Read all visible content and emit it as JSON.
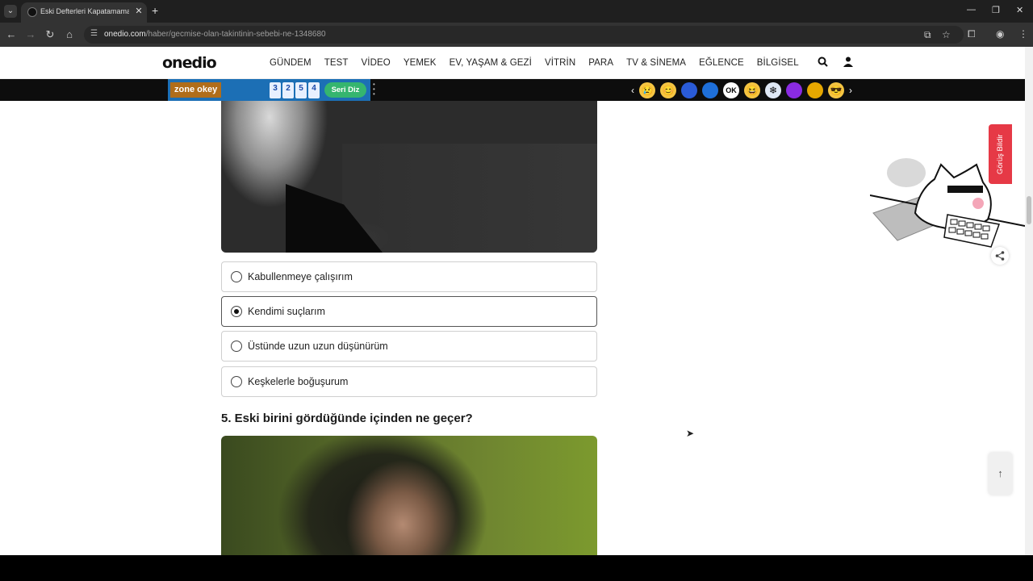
{
  "browser": {
    "tab_title": "Eski Defterleri Kapatamamanın",
    "tab_close": "✕",
    "new_tab": "+",
    "url_host": "onedio.com",
    "url_path": "/haber/gecmise-olan-takintinin-sebebi-ne-1348680"
  },
  "site": {
    "logo": "onedio",
    "menu": [
      "GÜNDEM",
      "TEST",
      "VİDEO",
      "YEMEK",
      "EV, YAŞAM & GEZİ",
      "VİTRİN",
      "PARA",
      "TV & SİNEMA",
      "EĞLENCE",
      "BİLGİSEL"
    ]
  },
  "ad": {
    "logo": "zone okey",
    "tiles": [
      "3",
      "2",
      "5",
      "4"
    ],
    "button": "Seri Diz"
  },
  "quiz": {
    "options": [
      {
        "label": "Kabullenmeye çalışırım",
        "selected": false
      },
      {
        "label": "Kendimi suçlarım",
        "selected": true
      },
      {
        "label": "Üstünde uzun uzun düşünürüm",
        "selected": false
      },
      {
        "label": "Keşkelerle boğuşurum",
        "selected": false
      }
    ],
    "question": "5. Eski birini gördüğünde içinden ne geçer?"
  },
  "side": {
    "feedback": "Görüş Bildir"
  },
  "colors": {
    "feedback_red": "#e63946",
    "ad_green": "#35b56f",
    "ad_blue": "#1c6fb5"
  }
}
